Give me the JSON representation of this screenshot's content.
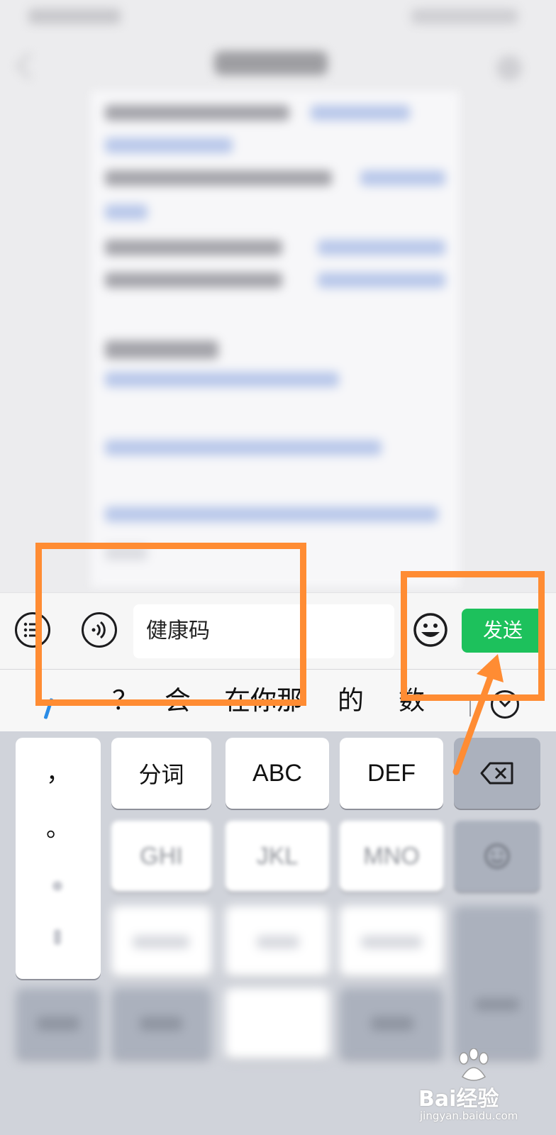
{
  "input_bar": {
    "text_value": "健康码",
    "send_label": "发送"
  },
  "candidates": {
    "items": [
      "？",
      "会",
      "在你那",
      "的",
      "数"
    ]
  },
  "keyboard": {
    "punctuation": [
      "，",
      "。"
    ],
    "row1": [
      "分词",
      "ABC",
      "DEF"
    ],
    "row2": [
      "GHI",
      "JKL",
      "MNO"
    ]
  },
  "watermark": {
    "brand": "Bai经验",
    "domain": "jingyan.baidu.com"
  },
  "colors": {
    "send_button": "#1dc15c",
    "annotation": "#ff8c33",
    "cursor": "#2a8ce6"
  },
  "icons": {
    "list": "list-icon",
    "voice": "voice-icon",
    "emoji": "emoji-icon",
    "expand": "expand-icon",
    "backspace": "backspace-icon"
  }
}
